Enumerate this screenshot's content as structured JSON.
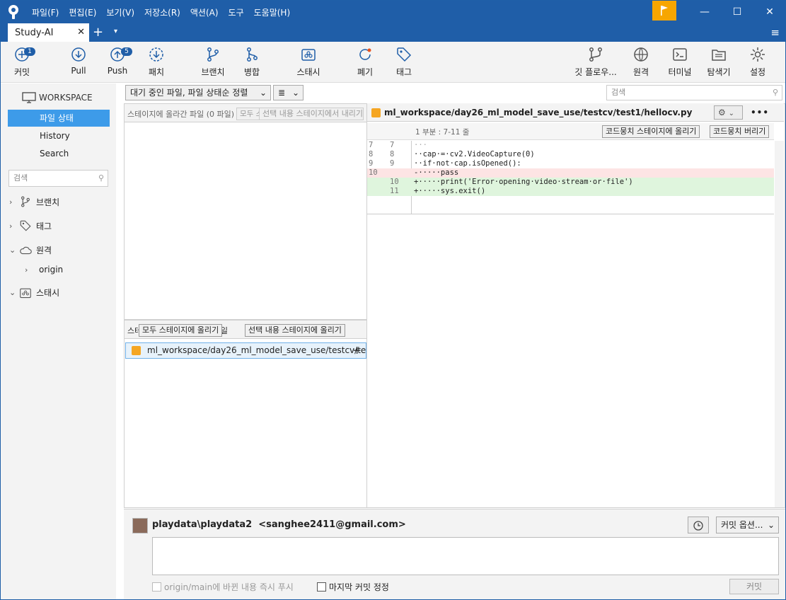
{
  "menu": [
    "파일(F)",
    "편집(E)",
    "보기(V)",
    "저장소(R)",
    "액션(A)",
    "도구",
    "도움말(H)"
  ],
  "window": {
    "minimize": "—",
    "maximize": "☐",
    "close": "✕"
  },
  "tab": {
    "title": "Study-AI",
    "close": "✕",
    "add": "+",
    "more": "▾",
    "menu": "≡"
  },
  "toolbar": {
    "commit": {
      "label": "커밋",
      "badge": "1"
    },
    "pull": {
      "label": "Pull"
    },
    "push": {
      "label": "Push",
      "badge": "5"
    },
    "fetch": {
      "label": "패치"
    },
    "branch": {
      "label": "브랜치"
    },
    "merge": {
      "label": "병합"
    },
    "stash": {
      "label": "스태시"
    },
    "discard": {
      "label": "폐기"
    },
    "tag": {
      "label": "태그"
    },
    "gitflow": {
      "label": "깃 플로우..."
    },
    "remote": {
      "label": "원격"
    },
    "terminal": {
      "label": "터미널"
    },
    "explorer": {
      "label": "탐색기"
    },
    "settings": {
      "label": "설정"
    }
  },
  "sidebar": {
    "workspace": "WORKSPACE",
    "items": [
      {
        "label": "파일 상태",
        "selected": true
      },
      {
        "label": "History",
        "selected": false
      },
      {
        "label": "Search",
        "selected": false
      }
    ],
    "search_placeholder": "검색",
    "tree": [
      {
        "label": "브랜치",
        "expanded": false
      },
      {
        "label": "태그",
        "expanded": false
      },
      {
        "label": "원격",
        "expanded": true
      },
      {
        "label": "origin",
        "expanded": false
      },
      {
        "label": "스태시",
        "expanded": true
      }
    ]
  },
  "filter": {
    "status_dropdown": "대기 중인 파일, 파일 상태순 정렬",
    "view_dropdown": "≣",
    "search_placeholder": "검색"
  },
  "staged": {
    "title": "스테이지에 올라간 파일 (0 파일)",
    "unstage_all": "모두 스테이지에서 내리기",
    "unstage_selected": "선택 내용 스테이지에서 내리기"
  },
  "unstaged": {
    "title": "스테이지에 올라가지 않은 파일",
    "stage_all": "모두 스테이지에 올리기",
    "stage_selected": "선택 내용 스테이지에 올리기",
    "files": [
      {
        "path": "ml_workspace/day26_ml_model_save_use/testcv/tes...",
        "action": "+"
      }
    ]
  },
  "diff": {
    "file_path": "ml_workspace/day26_ml_model_save_use/testcv/test1/hellocv.py",
    "more": "•••",
    "hunk_title": "1 부분 : 7-11 줄",
    "stage_hunk": "코드뭉치 스테이지에 올리기",
    "discard_hunk": "코드뭉치 버리기",
    "lines": [
      {
        "old": "7",
        "new": "7",
        "text": "···",
        "type": "ctx"
      },
      {
        "old": "8",
        "new": "8",
        "text": "··cap·=·cv2.VideoCapture(0)",
        "type": "ctx"
      },
      {
        "old": "9",
        "new": "9",
        "text": "··if·not·cap.isOpened():",
        "type": "ctx"
      },
      {
        "old": "10",
        "new": "",
        "text": "-·····pass",
        "type": "del"
      },
      {
        "old": "",
        "new": "10",
        "text": "+·····print('Error·opening·video·stream·or·file')",
        "type": "add"
      },
      {
        "old": "",
        "new": "11",
        "text": "+·····sys.exit()",
        "type": "add"
      }
    ]
  },
  "commit": {
    "author": "playdata\\playdata2  <sanghee2411@gmail.com>",
    "options": "커밋 옵션...",
    "push_immediately": "origin/main에 바뀐 내용 즉시 푸시",
    "amend": "마지막 커밋 정정",
    "commit_button": "커밋"
  },
  "colors": {
    "titlebar": "#1f5ea8",
    "accent": "#3d9be9",
    "flag": "#f7a600"
  }
}
